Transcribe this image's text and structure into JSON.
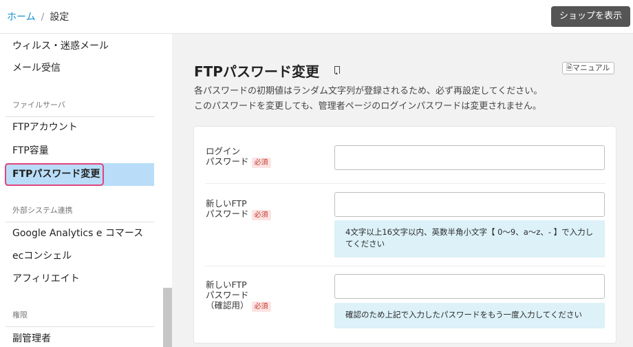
{
  "header": {
    "breadcrumb_home": "ホーム",
    "breadcrumb_sep": "/",
    "breadcrumb_current": "設定",
    "shop_button": "ショップを表示"
  },
  "sidebar": {
    "items_top": [
      "ウィルス・迷惑メール",
      "メール受信"
    ],
    "section_file": "ファイルサーバ",
    "items_file": [
      "FTPアカウント",
      "FTP容量",
      "FTPパスワード変更"
    ],
    "section_external": "外部システム連携",
    "items_external": [
      "Google Analytics e コマース",
      "ecコンシェル",
      "アフィリエイト"
    ],
    "section_rights": "権限",
    "items_rights": [
      "副管理者"
    ]
  },
  "main": {
    "title": "FTPパスワード変更",
    "manual_button": "マニュアル",
    "desc_line1": "各パスワードの初期値はランダム文字列が登録されるため、必ず再設定してください。",
    "desc_line2": "このパスワードを変更しても、管理者ページのログインパスワードは変更されません。",
    "required": "必須",
    "fields": [
      {
        "label_line1": "ログイン",
        "label_line2": "パスワード",
        "label_line3": "",
        "value": ""
      },
      {
        "label_line1": "新しいFTP",
        "label_line2": "パスワード",
        "label_line3": "",
        "value": "",
        "hint": "4文字以上16文字以内、英数半角小文字【 0～9、a～z、- 】で入力してください"
      },
      {
        "label_line1": "新しいFTP",
        "label_line2": "パスワード",
        "label_line3": "（確認用）",
        "value": "",
        "hint": "確認のため上記で入力したパスワードをもう一度入力してください"
      }
    ]
  },
  "colors": {
    "link": "#1a8fd0",
    "active_bg": "#b9ddf8",
    "active_ring": "#e0457b",
    "hint_bg": "#dcf1f8",
    "required_bg": "#fde3e3",
    "required_text": "#c0392b"
  }
}
